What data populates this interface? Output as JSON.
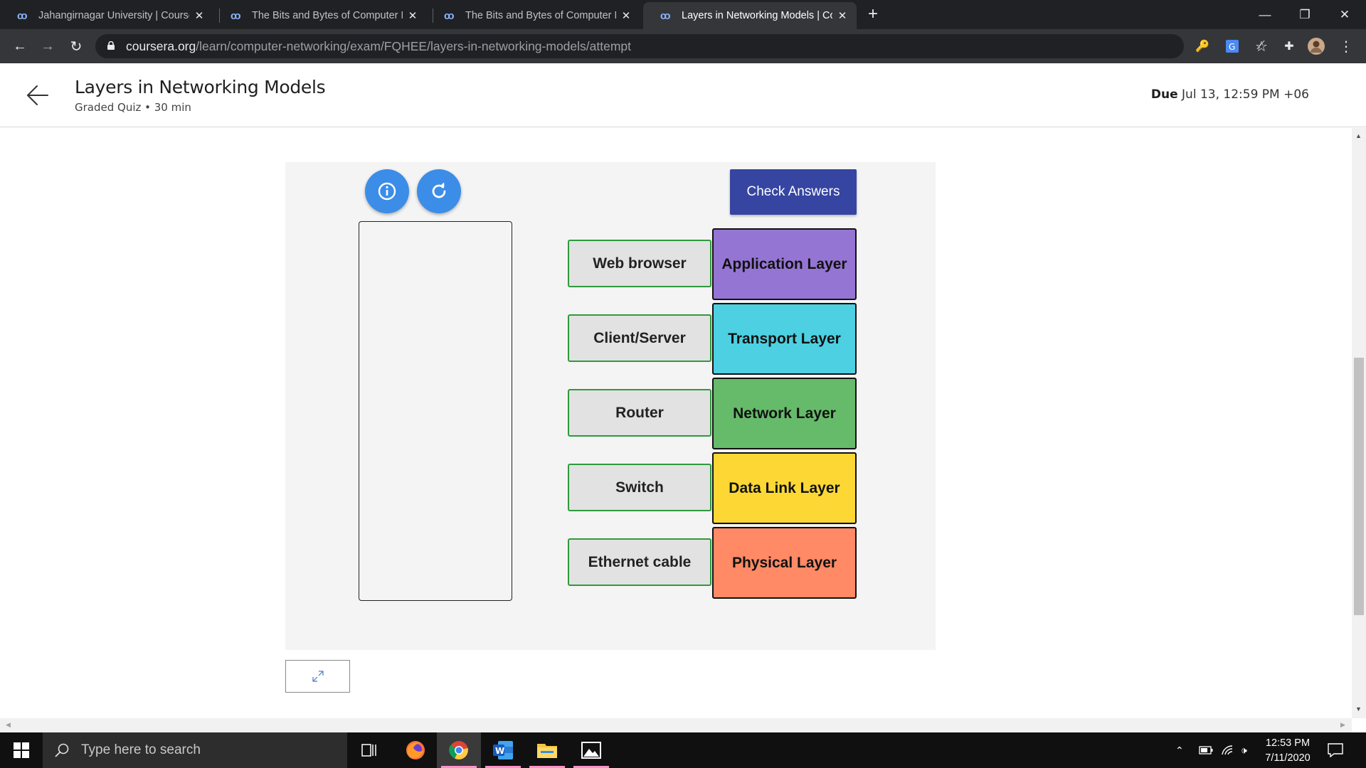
{
  "browser": {
    "tabs": [
      {
        "title": "Jahangirnagar University | Course"
      },
      {
        "title": "The Bits and Bytes of Computer N"
      },
      {
        "title": "The Bits and Bytes of Computer N"
      },
      {
        "title": "Layers in Networking Models | Co"
      }
    ],
    "active_tab": 3,
    "url_host": "coursera.org",
    "url_path": "/learn/computer-networking/exam/FQHEE/layers-in-networking-models/attempt"
  },
  "header": {
    "title": "Layers in Networking Models",
    "subtitle": "Graded Quiz • 30 min",
    "due_label": "Due",
    "due_value": "Jul 13, 12:59 PM +06"
  },
  "quiz": {
    "check_label": "Check Answers",
    "items": [
      "Web browser",
      "Client/Server",
      "Router",
      "Switch",
      "Ethernet cable"
    ],
    "layers": [
      {
        "label": "Application Layer",
        "color": "#9575d4"
      },
      {
        "label": "Transport Layer",
        "color": "#4dd0e2"
      },
      {
        "label": "Network Layer",
        "color": "#66bb6a"
      },
      {
        "label": "Data Link Layer",
        "color": "#fdd835"
      },
      {
        "label": "Physical Layer",
        "color": "#ff8a65"
      }
    ]
  },
  "taskbar": {
    "search_placeholder": "Type here to search",
    "time": "12:53 PM",
    "date": "7/11/2020"
  }
}
